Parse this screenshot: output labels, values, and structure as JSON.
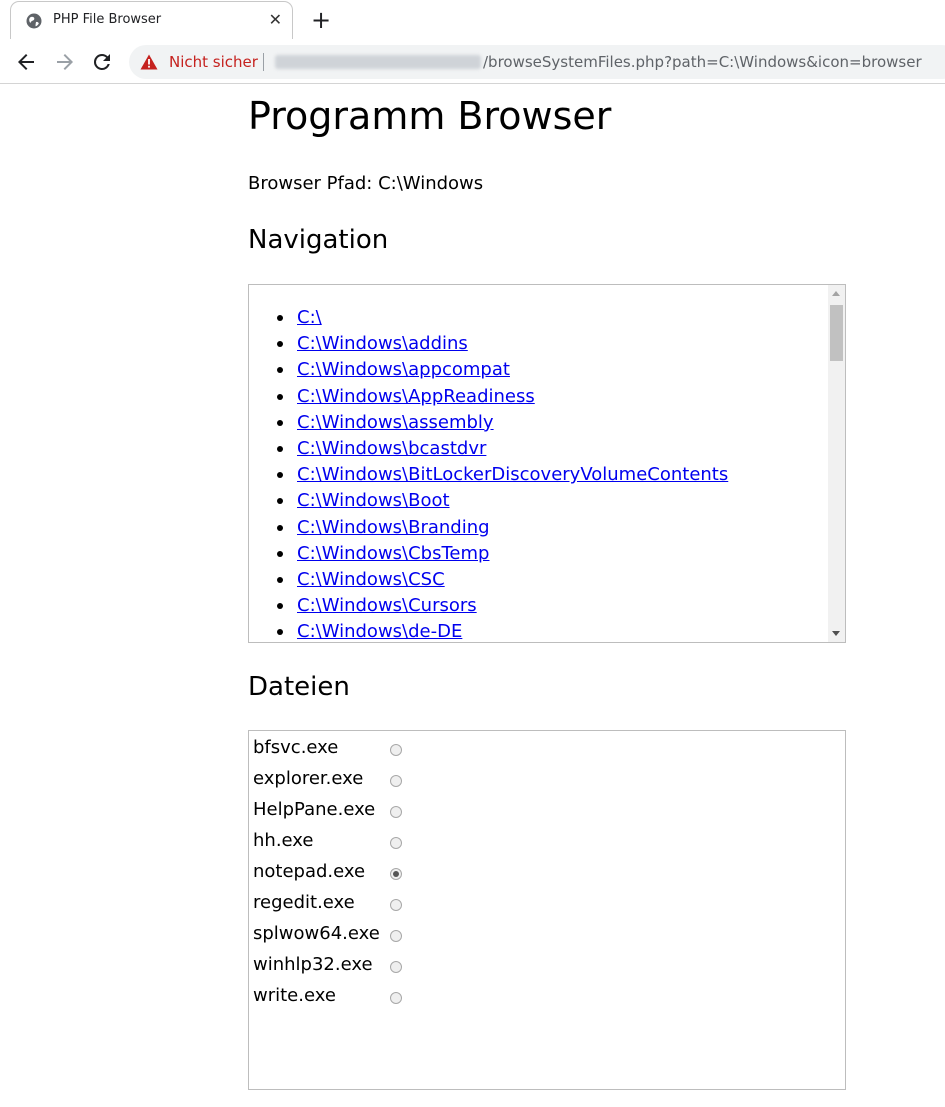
{
  "tab": {
    "title": "PHP File Browser",
    "close_glyph": "✕",
    "icon": "globe-icon"
  },
  "newtab": {
    "glyph": "+"
  },
  "toolbar": {
    "back_icon": "back-arrow-icon",
    "forward_icon": "forward-arrow-icon",
    "reload_icon": "reload-icon",
    "security_warning": "Nicht sicher",
    "url_path": "/browseSystemFiles.php?path=C:\\Windows&icon=browser"
  },
  "page": {
    "title": "Programm Browser",
    "path_line": "Browser Pfad: C:\\Windows",
    "navigation_heading": "Navigation",
    "files_heading": "Dateien"
  },
  "navigation": {
    "links": [
      "C:\\",
      "C:\\Windows\\addins",
      "C:\\Windows\\appcompat",
      "C:\\Windows\\AppReadiness",
      "C:\\Windows\\assembly",
      "C:\\Windows\\bcastdvr",
      "C:\\Windows\\BitLockerDiscoveryVolumeContents",
      "C:\\Windows\\Boot",
      "C:\\Windows\\Branding",
      "C:\\Windows\\CbsTemp",
      "C:\\Windows\\CSC",
      "C:\\Windows\\Cursors",
      "C:\\Windows\\de-DE"
    ]
  },
  "files": {
    "items": [
      {
        "name": "bfsvc.exe",
        "checked": false
      },
      {
        "name": "explorer.exe",
        "checked": false
      },
      {
        "name": "HelpPane.exe",
        "checked": false
      },
      {
        "name": "hh.exe",
        "checked": false
      },
      {
        "name": "notepad.exe",
        "checked": true
      },
      {
        "name": "regedit.exe",
        "checked": false
      },
      {
        "name": "splwow64.exe",
        "checked": false
      },
      {
        "name": "winhlp32.exe",
        "checked": false
      },
      {
        "name": "write.exe",
        "checked": false
      }
    ]
  },
  "colors": {
    "link": "#0000ee",
    "warning": "#c5221f"
  }
}
